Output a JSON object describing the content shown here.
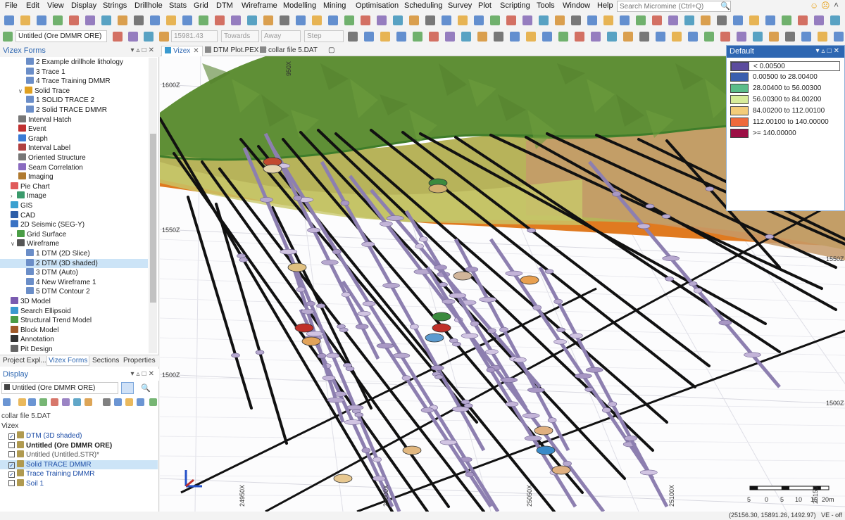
{
  "menu": [
    "File",
    "Edit",
    "View",
    "Display",
    "Strings",
    "Drillhole",
    "Stats",
    "Grid",
    "DTM",
    "Wireframe",
    "Modelling",
    "Mining",
    "Optimisation",
    "Scheduling",
    "Survey",
    "Plot",
    "Scripting",
    "Tools",
    "Window",
    "Help"
  ],
  "search_placeholder": "Search Micromine (Ctrl+Q)",
  "toolbar2": {
    "form_combo": "Untitled (Ore DMMR ORE)",
    "coord_value": "15981.43",
    "towards": "Towards",
    "away": "Away",
    "step": "Step"
  },
  "vizex_forms": {
    "title": "Vizex Forms",
    "items": [
      {
        "label": "2 Example drillhole lithology",
        "indent": 3,
        "icon": "list",
        "sel": false
      },
      {
        "label": "3 Trace 1",
        "indent": 3,
        "icon": "list",
        "sel": false
      },
      {
        "label": "4 Trace Training DMMR",
        "indent": 3,
        "icon": "list",
        "sel": false
      },
      {
        "label": "Solid Trace",
        "indent": 2,
        "icon": "solid-trace",
        "exp": "v",
        "sel": false
      },
      {
        "label": "1 SOLID TRACE 2",
        "indent": 3,
        "icon": "list",
        "sel": false
      },
      {
        "label": "2 Solid TRACE DMMR",
        "indent": 3,
        "icon": "list",
        "sel": false
      },
      {
        "label": "Interval Hatch",
        "indent": 2,
        "icon": "hatch",
        "sel": false
      },
      {
        "label": "Event",
        "indent": 2,
        "icon": "event",
        "sel": false
      },
      {
        "label": "Graph",
        "indent": 2,
        "icon": "graph",
        "sel": false
      },
      {
        "label": "Interval Label",
        "indent": 2,
        "icon": "label",
        "sel": false
      },
      {
        "label": "Oriented Structure",
        "indent": 2,
        "icon": "oriented",
        "sel": false
      },
      {
        "label": "Seam Correlation",
        "indent": 2,
        "icon": "seam",
        "sel": false
      },
      {
        "label": "Imaging",
        "indent": 2,
        "icon": "imaging",
        "sel": false
      },
      {
        "label": "Pie Chart",
        "indent": 1,
        "icon": "pie",
        "sel": false
      },
      {
        "label": "Image",
        "indent": 1,
        "icon": "image",
        "exp": ">",
        "sel": false
      },
      {
        "label": "GIS",
        "indent": 1,
        "icon": "gis",
        "sel": false
      },
      {
        "label": "CAD",
        "indent": 1,
        "icon": "cad",
        "sel": false
      },
      {
        "label": "2D Seismic (SEG-Y)",
        "indent": 1,
        "icon": "seismic",
        "sel": false
      },
      {
        "label": "Grid Surface",
        "indent": 1,
        "icon": "grid",
        "exp": ">",
        "sel": false
      },
      {
        "label": "Wireframe",
        "indent": 1,
        "icon": "wireframe",
        "exp": "v",
        "sel": false
      },
      {
        "label": "1 DTM (2D Slice)",
        "indent": 3,
        "icon": "list",
        "sel": false
      },
      {
        "label": "2 DTM (3D shaded)",
        "indent": 3,
        "icon": "list",
        "sel": true
      },
      {
        "label": "3 DTM (Auto)",
        "indent": 3,
        "icon": "list",
        "sel": false
      },
      {
        "label": "4 New Wireframe 1",
        "indent": 3,
        "icon": "list",
        "sel": false
      },
      {
        "label": "5 DTM Contour 2",
        "indent": 3,
        "icon": "list",
        "sel": false
      },
      {
        "label": "3D Model",
        "indent": 1,
        "icon": "model",
        "sel": false
      },
      {
        "label": "Search Ellipsoid",
        "indent": 1,
        "icon": "ellipsoid",
        "sel": false
      },
      {
        "label": "Structural Trend Model",
        "indent": 1,
        "icon": "trend",
        "sel": false
      },
      {
        "label": "Block Model",
        "indent": 1,
        "icon": "block",
        "sel": false
      },
      {
        "label": "Annotation",
        "indent": 1,
        "icon": "annotation",
        "sel": false
      },
      {
        "label": "Pit Design",
        "indent": 1,
        "icon": "pit",
        "sel": false
      }
    ]
  },
  "pane_tabs": [
    "Project Expl...",
    "Vizex Forms",
    "Sections",
    "Properties"
  ],
  "display": {
    "title": "Display",
    "combo": "Untitled (Ore DMMR ORE)",
    "root_label": "collar file 5.DAT",
    "vizex_label": "Vizex",
    "layers": [
      {
        "label": "DTM (3D shaded)",
        "checked": true,
        "color": "#1f4fa8",
        "bold": false,
        "sel": false
      },
      {
        "label": "Untitled (Ore DMMR ORE)",
        "checked": false,
        "color": "#222222",
        "bold": true,
        "sel": false
      },
      {
        "label": "Untitled (Untitled.STR)*",
        "checked": false,
        "color": "#555555",
        "bold": false,
        "sel": false
      },
      {
        "label": "Solid TRACE DMMR",
        "checked": true,
        "color": "#1f4fa8",
        "bold": false,
        "sel": true
      },
      {
        "label": "Trace Training DMMR",
        "checked": true,
        "color": "#1f4fa8",
        "bold": false,
        "sel": false
      },
      {
        "label": "Soil 1",
        "checked": false,
        "color": "#1f4fa8",
        "bold": false,
        "sel": false
      }
    ]
  },
  "doc_tabs": [
    "Vizex",
    "DTM Plot.PEX",
    "collar file 5.DAT"
  ],
  "legend": {
    "title": "Default",
    "rows": [
      {
        "label": "< 0.00500",
        "color": "#5b4b9e"
      },
      {
        "label": "0.00500 to 28.00400",
        "color": "#3a5fae"
      },
      {
        "label": "28.00400 to 56.00300",
        "color": "#5bbd8a"
      },
      {
        "label": "56.00300 to 84.00200",
        "color": "#d7ec9a"
      },
      {
        "label": "84.00200 to 112.00100",
        "color": "#f3cc79"
      },
      {
        "label": "112.00100 to 140.00000",
        "color": "#ef6a3c"
      },
      {
        "label": ">= 140.00000",
        "color": "#9c0f45"
      }
    ]
  },
  "axis_labels": {
    "z1600": "1600Z",
    "z1550": "1550Z",
    "z1550r": "1550Z",
    "z1500": "1500Z",
    "z1500r": "1500Z",
    "x950": "950X",
    "x5000": "25000X",
    "x5050": "25050X",
    "x5100": "25100X",
    "x4950": "24950X",
    "x5150": "25150"
  },
  "scale_bar": {
    "labels": [
      "5",
      "0",
      "5",
      "10",
      "15",
      "20m"
    ]
  },
  "status": {
    "coords": "(25156.30, 15891.26, 1492.97)",
    "ve": "VE - off"
  }
}
